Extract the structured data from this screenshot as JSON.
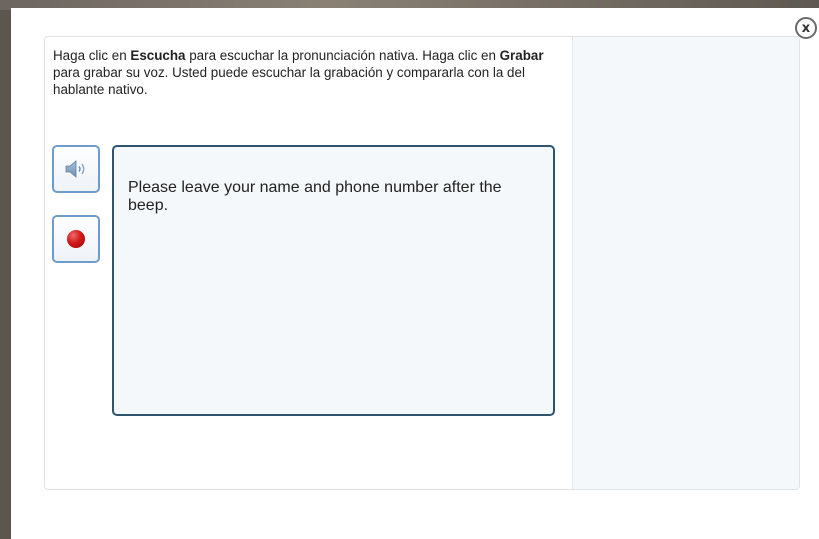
{
  "dialog": {
    "close_label": "x"
  },
  "instructions": {
    "p1": "Haga clic en ",
    "b1": "Escucha",
    "p2": " para escuchar la pronunciación nativa. Haga clic en ",
    "b2": "Grabar",
    "p3": " para grabar su voz. Usted puede escuchar la grabación y compararla con la del hablante nativo."
  },
  "phrase": {
    "text": "Please leave your name and phone number after the beep."
  },
  "icons": {
    "listen": "speaker-icon",
    "record": "record-icon"
  },
  "colors": {
    "button_border": "#6f9ccc",
    "text_box_border": "#2e5470",
    "record_red": "#d01818",
    "pane_bg": "#f4f8fb"
  }
}
